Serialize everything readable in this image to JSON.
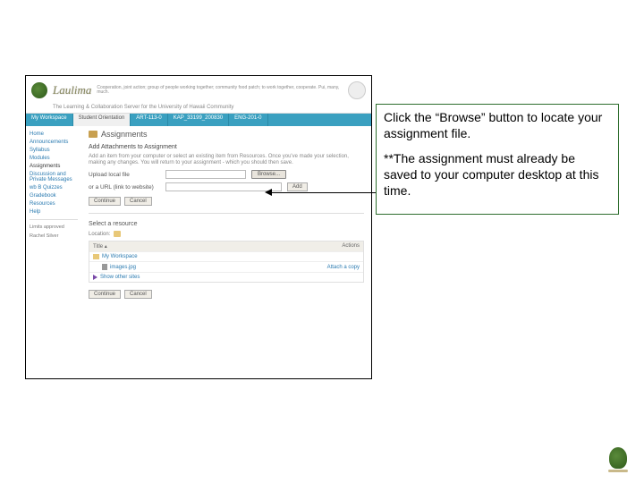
{
  "header": {
    "brand": "Laulima",
    "tagline": "Cooperation, joint action; group of people working together; community food patch; to work together, cooperate. Pui, many, much.",
    "subline": "The Learning & Collaboration Server for the University of Hawaii Community"
  },
  "tabs": [
    {
      "label": "My Workspace"
    },
    {
      "label": "Student Orientation",
      "active": true
    },
    {
      "label": "ART-113-0"
    },
    {
      "label": "KAP_33199_200830"
    },
    {
      "label": "ENG-201-0"
    }
  ],
  "sidebar": {
    "items": [
      "Home",
      "Announcements",
      "Syllabus",
      "Modules",
      "Assignments",
      "Discussion and Private Messages",
      "wb B Quizzes",
      "Gradebook",
      "Resources",
      "Help"
    ],
    "active_index": 4,
    "meta1": "Limits approved",
    "meta2": "Rachel Silver"
  },
  "main": {
    "page_title": "Assignments",
    "section_title": "Add Attachments to Assignment",
    "help1": "Add an item from your computer or select an existing item from Resources. Once you've made your selection, making any changes. You will return to your assignment - which you should then save.",
    "upload_label": "Upload local file",
    "browse_label": "Browse...",
    "url_label": "or a URL (link to website)",
    "add_label": "Add",
    "continue_label": "Continue",
    "cancel_label": "Cancel",
    "resource_title": "Select a resource",
    "location_label": "Location:",
    "table": {
      "col_title": "Title",
      "col_actions": "Actions",
      "rows": [
        {
          "title": "My Workspace",
          "action": ""
        },
        {
          "title": "images.jpg",
          "action": "Attach a copy"
        },
        {
          "title": "Show other sites",
          "action": ""
        }
      ]
    }
  },
  "callout": {
    "p1": "Click the “Browse” button to locate your assignment file.",
    "p2": "**The assignment must already be saved to your computer desktop at this time."
  }
}
